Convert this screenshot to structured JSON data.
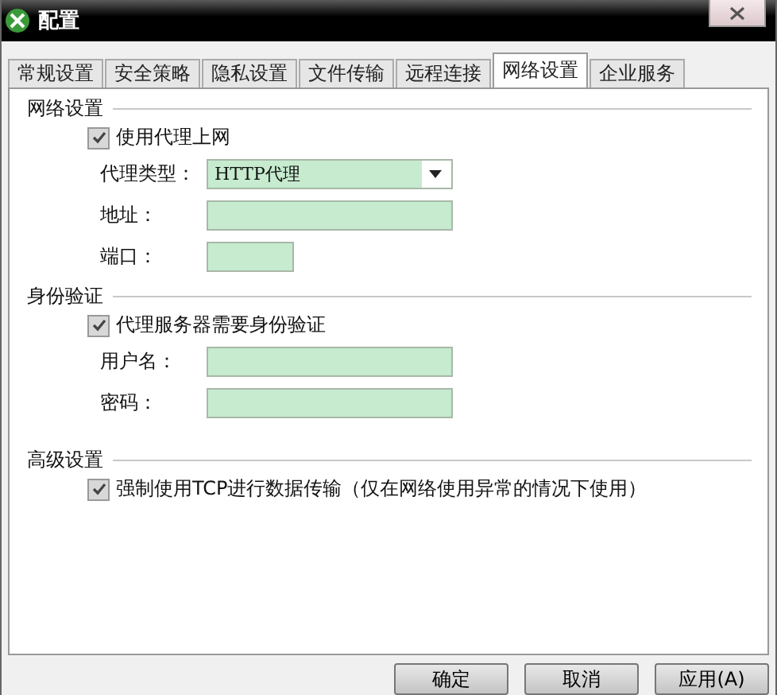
{
  "window": {
    "title": "配置"
  },
  "tabs": [
    {
      "label": "常规设置",
      "selected": false
    },
    {
      "label": "安全策略",
      "selected": false
    },
    {
      "label": "隐私设置",
      "selected": false
    },
    {
      "label": "文件传输",
      "selected": false
    },
    {
      "label": "远程连接",
      "selected": false
    },
    {
      "label": "网络设置",
      "selected": true
    },
    {
      "label": "企业服务",
      "selected": false
    }
  ],
  "sections": [
    {
      "title": "网络设置",
      "items": [
        {
          "kind": "checkbox",
          "label": "使用代理上网",
          "checked": true
        },
        {
          "kind": "select",
          "label": "代理类型：",
          "value": "HTTP代理"
        },
        {
          "kind": "field",
          "label": "地址："
        },
        {
          "kind": "shortfield",
          "label": "端口："
        }
      ]
    },
    {
      "title": "身份验证",
      "items": [
        {
          "kind": "checkbox",
          "label": "代理服务器需要身份验证",
          "checked": true
        },
        {
          "kind": "field",
          "label": "用户名："
        },
        {
          "kind": "field",
          "label": "密码："
        }
      ]
    },
    {
      "title": "高级设置",
      "items": [
        {
          "kind": "checkbox",
          "label": "强制使用TCP进行数据传输（仅在网络使用异常的情况下使用）",
          "checked": true
        }
      ]
    }
  ],
  "buttons": [
    "确定",
    "取消",
    "应用(A)"
  ]
}
